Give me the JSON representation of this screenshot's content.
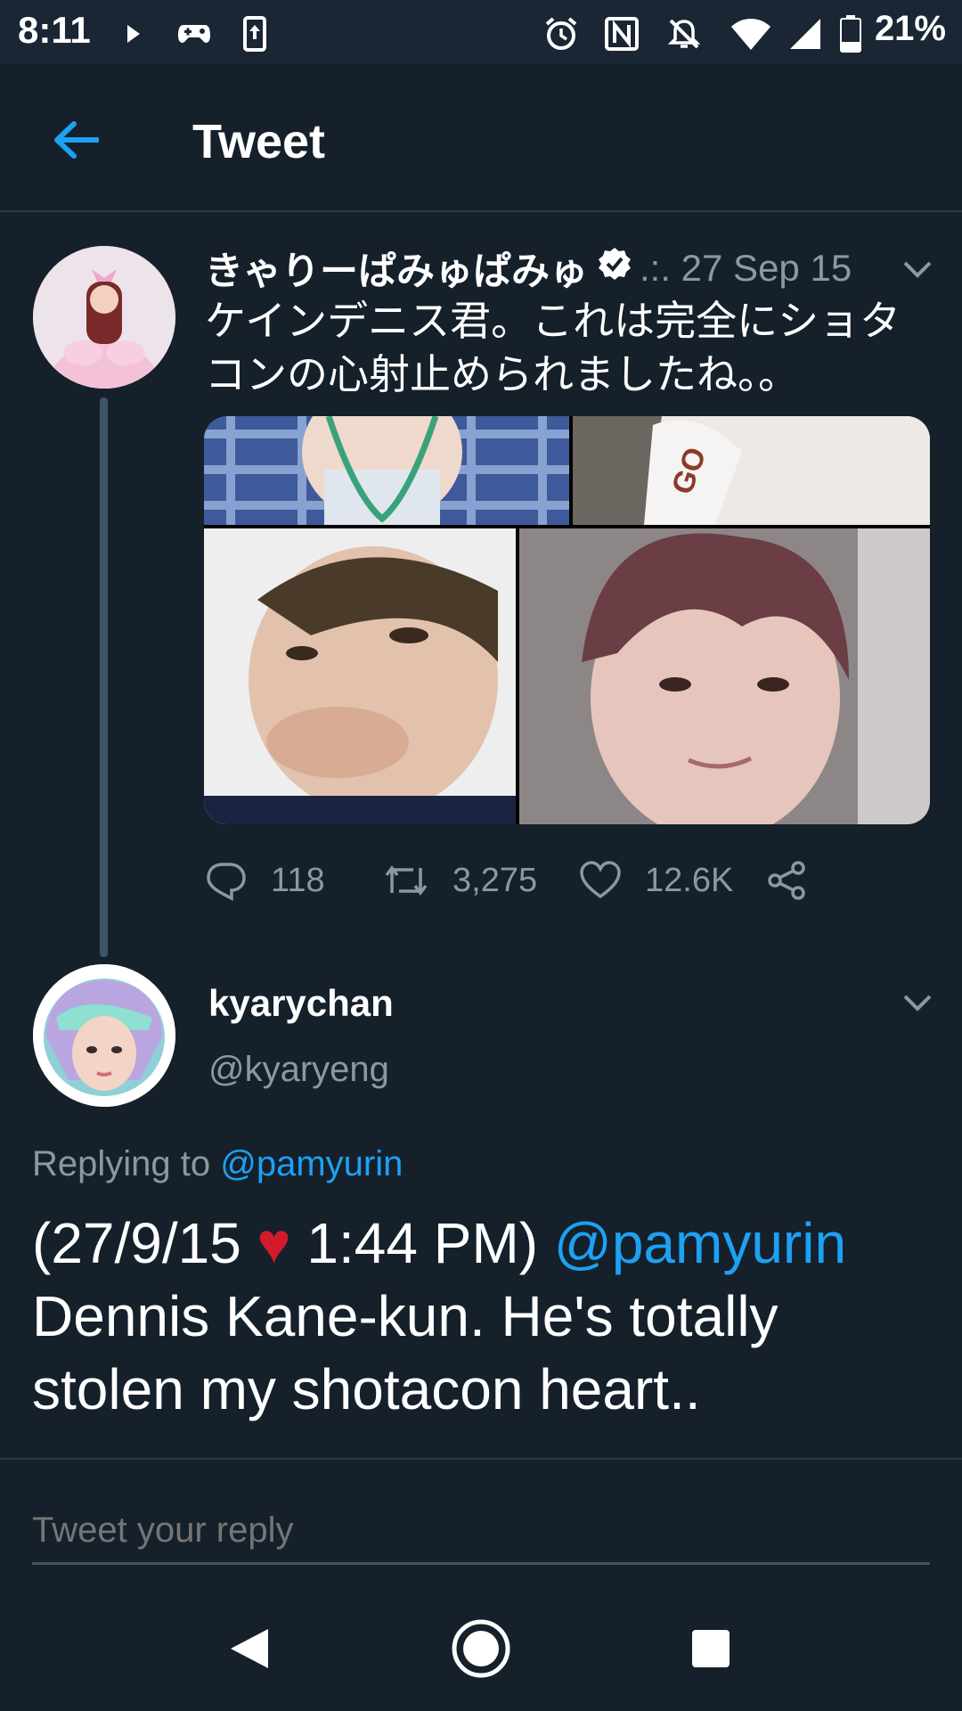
{
  "status_bar": {
    "time": "8:11",
    "battery": "21%",
    "icons": [
      "play-icon",
      "game-controller-icon",
      "upload-icon",
      "alarm-icon",
      "nfc-icon",
      "mute-icon",
      "wifi-icon",
      "signal-icon",
      "battery-icon"
    ]
  },
  "header": {
    "title": "Tweet",
    "back_icon": "arrow-left-icon"
  },
  "tweet": {
    "display_name": "きゃりーぱみゅぱみゅ",
    "meta": ".:. 27 Sep 15",
    "text": "ケインデニス君。これは完全にショタコンの心射止められましたね。。",
    "actions": {
      "replies": "118",
      "retweets": "3,275",
      "likes": "12.6K"
    }
  },
  "reply": {
    "name": "kyarychan",
    "handle": "@kyaryeng",
    "replying_prefix": "Replying to ",
    "replying_to": "@pamyurin",
    "body_prefix": "(27/9/15 ",
    "body_heart": "♥",
    "body_time": " 1:44 PM) ",
    "body_mention": "@pamyurin",
    "body_text": " Dennis Kane-kun. He's totally stolen my shotacon heart.."
  },
  "composer": {
    "placeholder": "Tweet your reply"
  },
  "colors": {
    "background": "#15202b",
    "accent": "#1da1f2",
    "muted": "#8899a6"
  }
}
